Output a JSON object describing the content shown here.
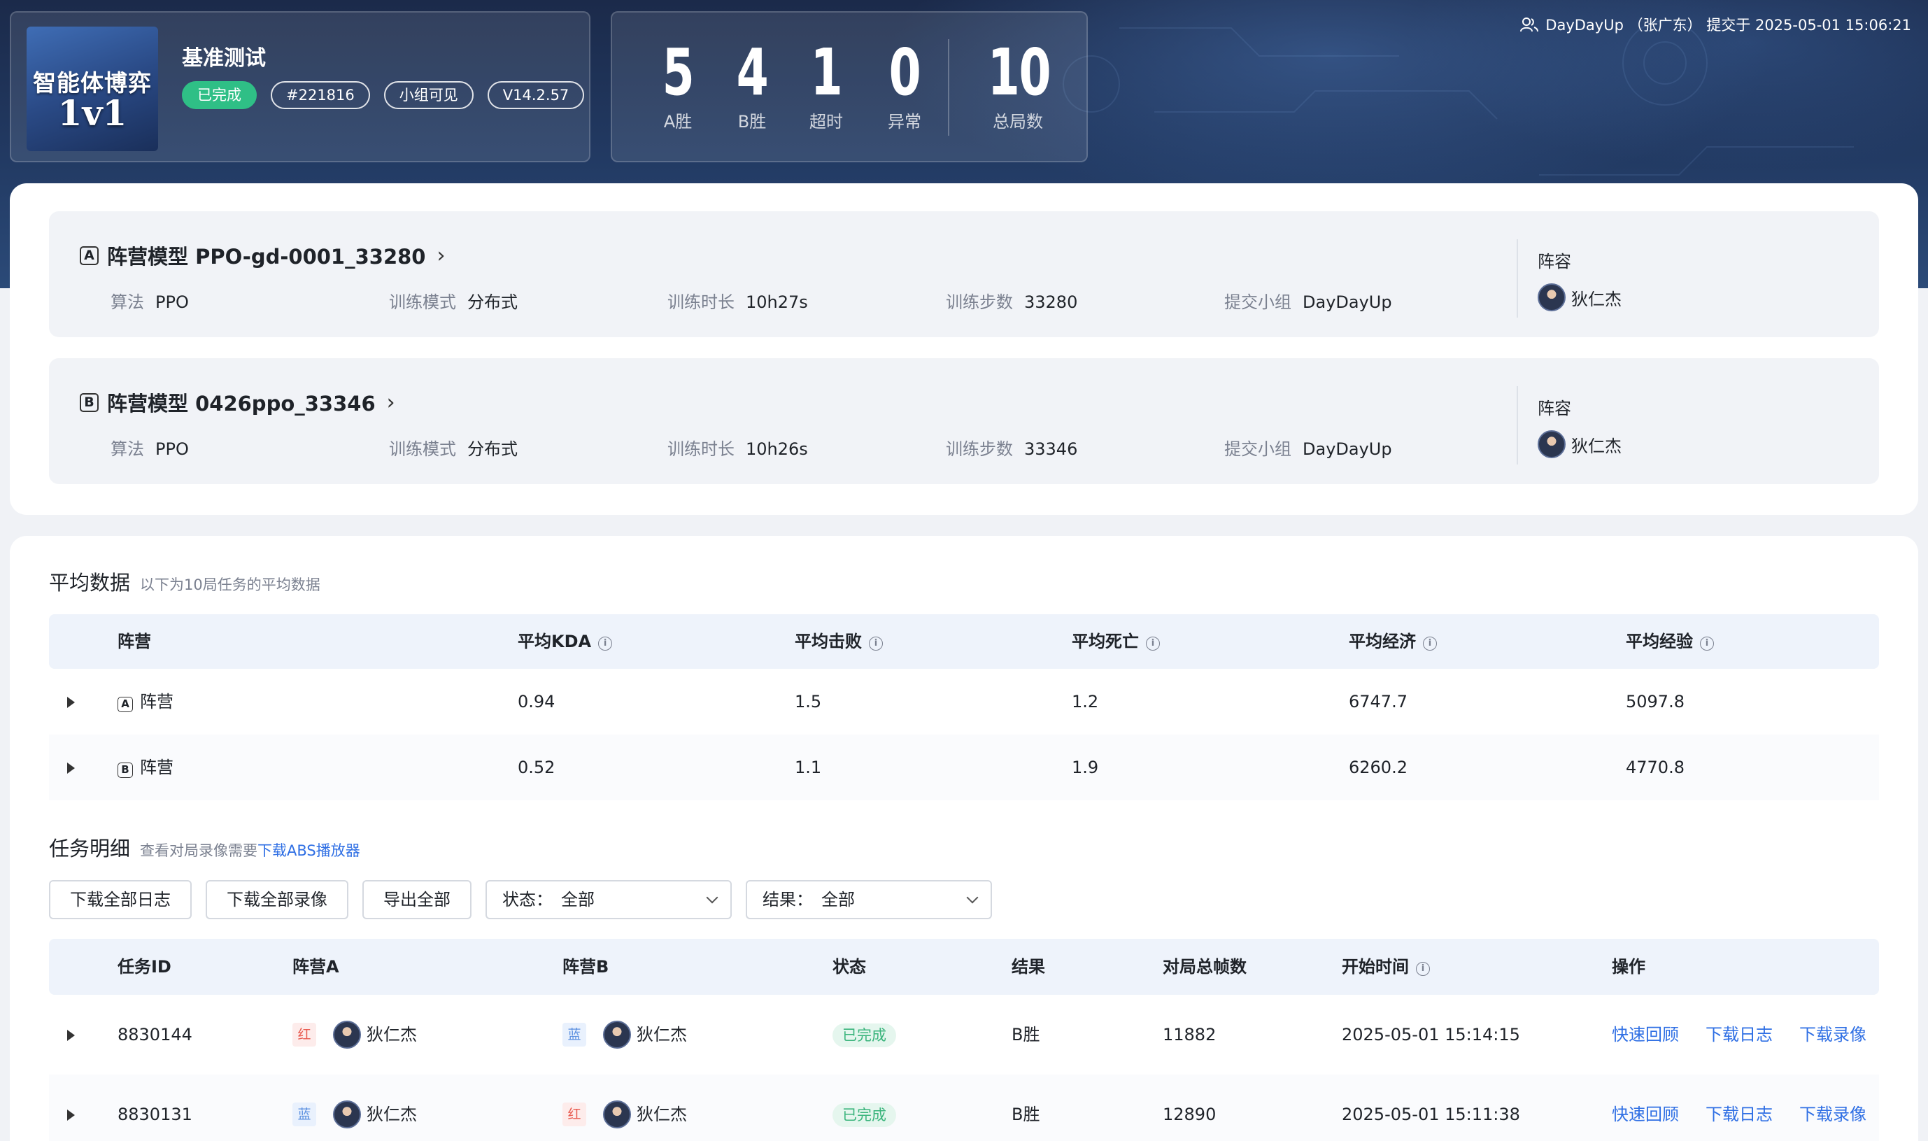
{
  "header": {
    "game_logo_line1": "智能体博弈",
    "game_logo_line2": "1v1",
    "title": "基准测试",
    "tags": [
      "已完成",
      "#221816",
      "小组可见",
      "V14.2.57"
    ],
    "stats": [
      {
        "value": "5",
        "label": "A胜"
      },
      {
        "value": "4",
        "label": "B胜"
      },
      {
        "value": "1",
        "label": "超时"
      },
      {
        "value": "0",
        "label": "异常"
      },
      {
        "value": "10",
        "label": "总局数"
      }
    ],
    "submit_info": "DayDayUp （张广东） 提交于 2025-05-01 15:06:21",
    "submit_icon": "user-group-icon"
  },
  "models": [
    {
      "side": "A",
      "title": "阵营模型 PPO-gd-0001_33280",
      "fields": [
        {
          "k": "算法",
          "v": "PPO"
        },
        {
          "k": "训练模式",
          "v": "分布式"
        },
        {
          "k": "训练时长",
          "v": "10h27s"
        },
        {
          "k": "训练步数",
          "v": "33280"
        },
        {
          "k": "提交小组",
          "v": "DayDayUp"
        }
      ],
      "lineup_label": "阵容",
      "hero": "狄仁杰"
    },
    {
      "side": "B",
      "title": "阵营模型 0426ppo_33346",
      "fields": [
        {
          "k": "算法",
          "v": "PPO"
        },
        {
          "k": "训练模式",
          "v": "分布式"
        },
        {
          "k": "训练时长",
          "v": "10h26s"
        },
        {
          "k": "训练步数",
          "v": "33346"
        },
        {
          "k": "提交小组",
          "v": "DayDayUp"
        }
      ],
      "lineup_label": "阵容",
      "hero": "狄仁杰"
    }
  ],
  "averages": {
    "title": "平均数据",
    "subtitle": "以下为10局任务的平均数据",
    "columns": [
      "阵营",
      "平均KDA",
      "平均击败",
      "平均死亡",
      "平均经济",
      "平均经验"
    ],
    "rows": [
      {
        "side": "A",
        "label": "阵营",
        "kda": "0.94",
        "kills": "1.5",
        "deaths": "1.2",
        "gold": "6747.7",
        "exp": "5097.8"
      },
      {
        "side": "B",
        "label": "阵营",
        "kda": "0.52",
        "kills": "1.1",
        "deaths": "1.9",
        "gold": "6260.2",
        "exp": "4770.8"
      }
    ]
  },
  "tasks": {
    "title": "任务明细",
    "subtitle": "查看对局录像需要",
    "subtitle_link": "下载ABS播放器",
    "buttons": [
      "下载全部日志",
      "下载全部录像",
      "导出全部"
    ],
    "filters": [
      {
        "label": "状态：",
        "value": "全部"
      },
      {
        "label": "结果：",
        "value": "全部"
      }
    ],
    "columns": [
      "任务ID",
      "阵营A",
      "阵营B",
      "状态",
      "结果",
      "对局总帧数",
      "开始时间",
      "操作"
    ],
    "rows": [
      {
        "id": "8830144",
        "a_side": "红",
        "a_hero": "狄仁杰",
        "b_side": "蓝",
        "b_hero": "狄仁杰",
        "status": "已完成",
        "result": "B胜",
        "frames": "11882",
        "start": "2025-05-01 15:14:15"
      },
      {
        "id": "8830131",
        "a_side": "蓝",
        "a_hero": "狄仁杰",
        "b_side": "红",
        "b_hero": "狄仁杰",
        "status": "已完成",
        "result": "B胜",
        "frames": "12890",
        "start": "2025-05-01 15:11:38"
      }
    ],
    "ops": [
      "快速回顾",
      "下载日志",
      "下载录像"
    ]
  }
}
